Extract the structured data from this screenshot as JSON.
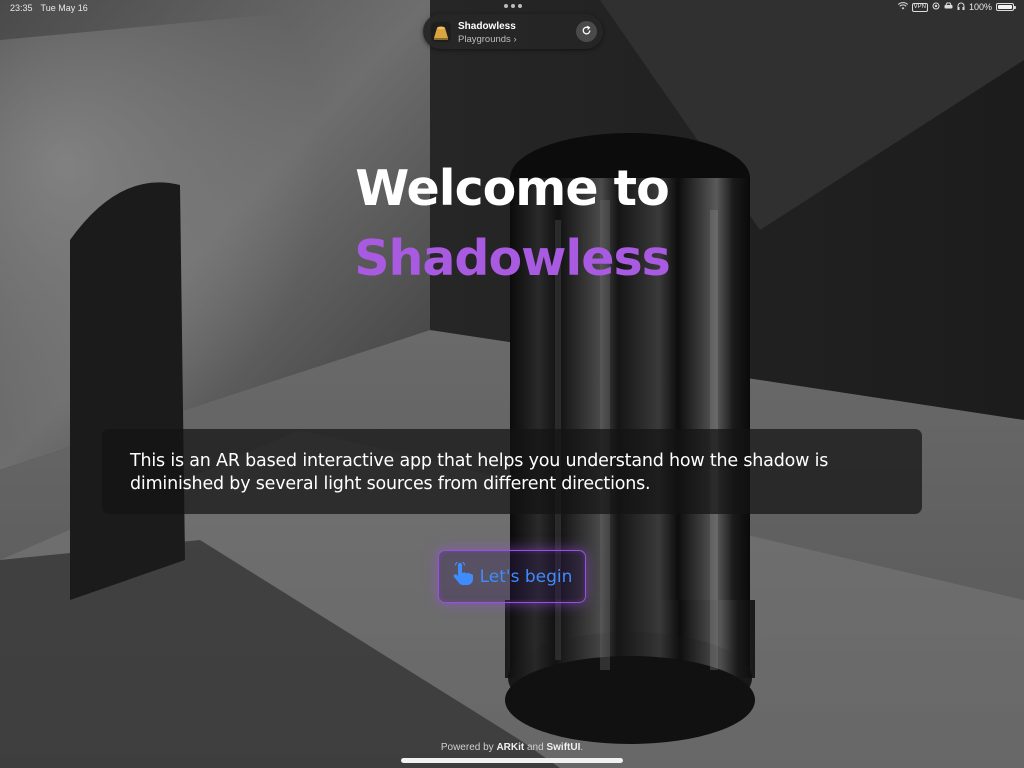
{
  "status_bar": {
    "time": "23:35",
    "date": "Tue May 16",
    "vpn": "VPN",
    "battery": "100%"
  },
  "app_pill": {
    "name": "Shadowless",
    "subtitle": "Playgrounds",
    "chevron": "›"
  },
  "main": {
    "title_line1": "Welcome to",
    "title_line2": "Shadowless",
    "description": "This is an AR based interactive app that helps you understand how the shadow is diminished by several light sources from different directions.",
    "begin_button_label": "Let's begin"
  },
  "footer": {
    "prefix": "Powered by",
    "tech1": "ARKit",
    "and": "and",
    "tech2": "SwiftUI",
    "suffix": "."
  },
  "colors": {
    "accent_purple": "#a85ae0",
    "button_text_blue": "#3f8cff",
    "button_border": "#9b4fe0"
  },
  "icons": {
    "reload": "arrow-clockwise-icon",
    "begin": "hand-tap-icon",
    "wifi": "wifi-icon",
    "battery": "battery-icon",
    "headphones": "headphones-icon"
  }
}
